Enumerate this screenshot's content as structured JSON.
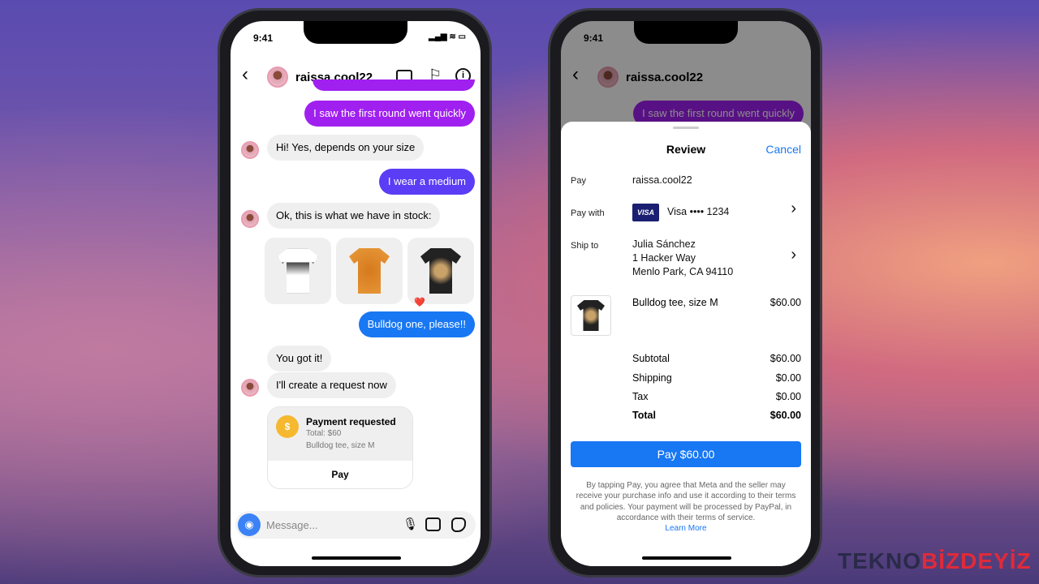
{
  "status_time": "9:41",
  "chat": {
    "username": "raissa.cool22",
    "messages": [
      {
        "from": "me",
        "text": "I saw the first round went quickly"
      },
      {
        "from": "them",
        "text": "Hi! Yes, depends on your size"
      },
      {
        "from": "me",
        "text": "I wear a medium"
      },
      {
        "from": "them",
        "text": "Ok, this is what we have in stock:"
      },
      {
        "from": "me",
        "text": "Bulldog one, please!!"
      },
      {
        "from": "them",
        "text": "You got it!"
      },
      {
        "from": "them",
        "text": "I'll create a request now"
      }
    ],
    "reaction": "❤️",
    "payment_card": {
      "title": "Payment requested",
      "total": "Total: $60",
      "item": "Bulldog tee, size M",
      "button": "Pay"
    },
    "composer_placeholder": "Message..."
  },
  "review": {
    "title": "Review",
    "cancel": "Cancel",
    "pay_label": "Pay",
    "pay_to": "raissa.cool22",
    "pay_with_label": "Pay with",
    "card_brand": "VISA",
    "card": "Visa •••• 1234",
    "ship_to_label": "Ship to",
    "ship_name": "Julia Sánchez",
    "ship_line1": "1 Hacker Way",
    "ship_line2": "Menlo Park, CA 94110",
    "item": "Bulldog tee, size M",
    "item_price": "$60.00",
    "subtotal_label": "Subtotal",
    "subtotal": "$60.00",
    "shipping_label": "Shipping",
    "shipping": "$0.00",
    "tax_label": "Tax",
    "tax": "$0.00",
    "total_label": "Total",
    "total": "$60.00",
    "pay_button": "Pay $60.00",
    "disclaimer": "By tapping Pay, you agree that Meta and the seller may receive your purchase info and use it according to their terms and policies. Your payment will be processed by PayPal, in accordance with their terms of service.",
    "learn_more": "Learn More"
  },
  "watermark": "TEKNOBIZDEYIZ",
  "colors": {
    "accent": "#1877f2",
    "purple": "#a020f0",
    "indigo": "#5b3df5",
    "pay_coin": "#f5b82e"
  }
}
